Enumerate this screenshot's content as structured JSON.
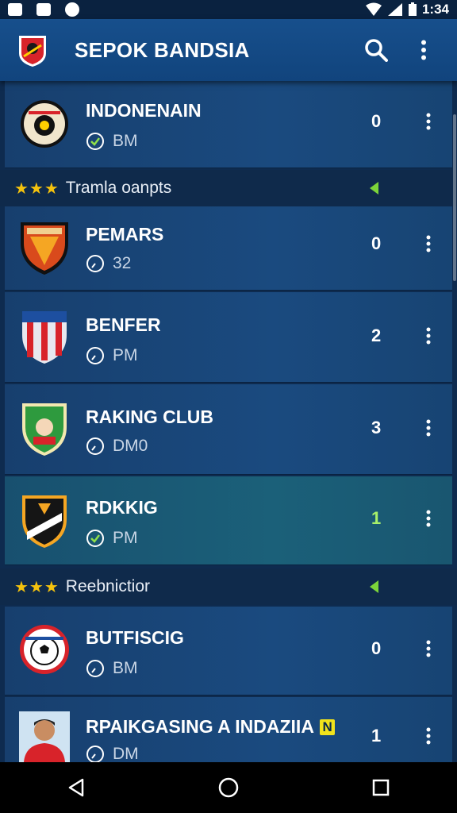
{
  "status_bar": {
    "time": "1:34"
  },
  "app_bar": {
    "title": "SEPOK BANDSIA",
    "search_icon": "search-icon",
    "overflow_icon": "more-vert-icon"
  },
  "rows": [
    {
      "name": "INDONENAIN",
      "sub": "BM",
      "score": "0",
      "sub_icon": "check-circle-icon"
    },
    {
      "name": "PEMARS",
      "sub": "32",
      "score": "0",
      "sub_icon": "timer-icon"
    },
    {
      "name": "BENFER",
      "sub": "PM",
      "score": "2",
      "sub_icon": "timer-icon"
    },
    {
      "name": "RAKING CLUB",
      "sub": "DM0",
      "score": "3",
      "sub_icon": "timer-icon"
    },
    {
      "name": "RDKKIG",
      "sub": "PM",
      "score": "1",
      "sub_icon": "check-circle-icon"
    },
    {
      "name": "BUTFISCIG",
      "sub": "BM",
      "score": "0",
      "sub_icon": "timer-icon"
    },
    {
      "name": "RPAIKGASING A INDAZIIA",
      "tag": "N",
      "sub": "DM",
      "score": "1",
      "sub_icon": "timer-icon"
    }
  ],
  "sections": [
    {
      "stars": "★★★",
      "title": "Tramla oanpts"
    },
    {
      "stars": "★★★",
      "title": "Reebnictior"
    }
  ],
  "colors": {
    "accent": "#f4c20d",
    "arrow": "#7cd43a",
    "bar": "#174f8c",
    "highlight": "#1b6079"
  }
}
